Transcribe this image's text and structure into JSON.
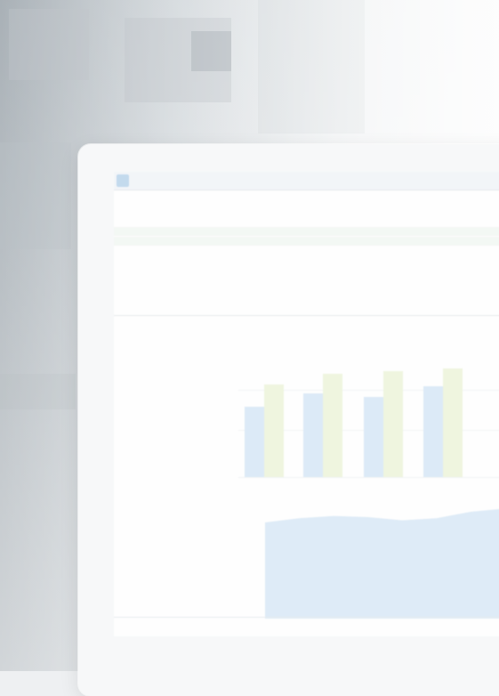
{
  "colors": {
    "bar_series_a": "#d9e9f7",
    "bar_series_b": "#eef5dc",
    "area_fill": "#dbeaf7",
    "accent": "#a9c6e2"
  },
  "app": {
    "title": "",
    "menu": [],
    "logo_icon": "app-logo-icon"
  },
  "table": {
    "headers": [],
    "rows": [],
    "total_label": ""
  },
  "charts": {
    "bar_section_title": "",
    "bar_legend": [],
    "bar_categories": [],
    "area_section_title": "",
    "area_legend": [],
    "area_categories": []
  },
  "chart_data": [
    {
      "type": "bar",
      "title": "",
      "categories": [
        "",
        "",
        "",
        ""
      ],
      "series": [
        {
          "values": [
            63,
            75,
            72,
            82
          ]
        },
        {
          "values": [
            83,
            93,
            95,
            98
          ]
        }
      ],
      "ylim": [
        0,
        100
      ]
    },
    {
      "type": "area",
      "title": "",
      "x": [
        0,
        1,
        2,
        3,
        4,
        5,
        6,
        7
      ],
      "series": [
        {
          "values": [
            90,
            94,
            96,
            95,
            92,
            94,
            100,
            103
          ]
        }
      ],
      "ylim": [
        0,
        110
      ]
    }
  ]
}
